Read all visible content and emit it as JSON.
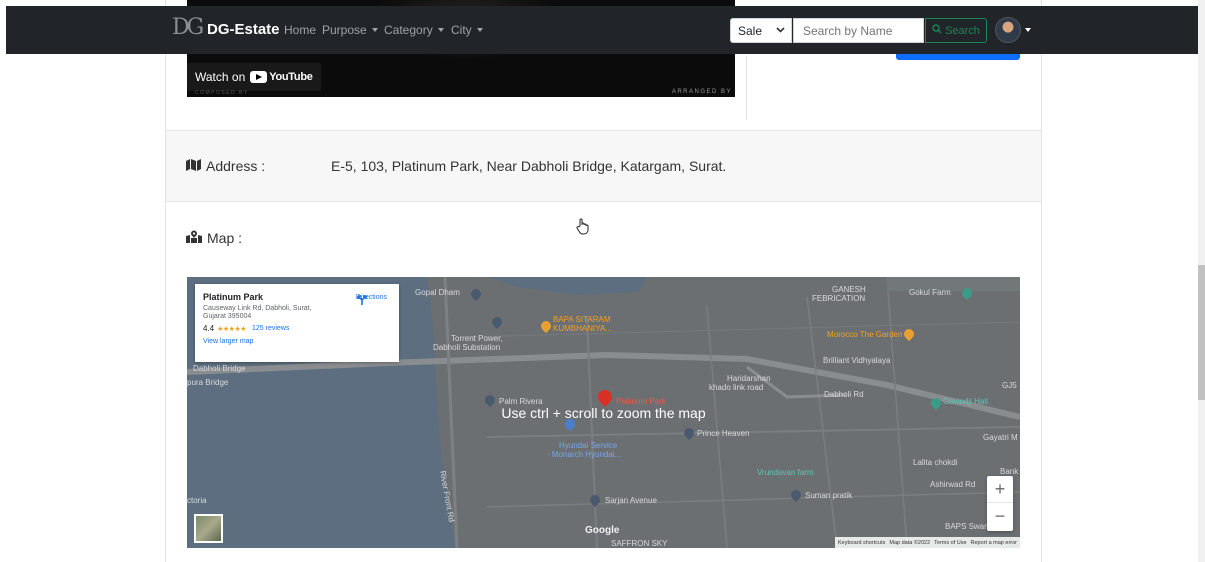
{
  "navbar": {
    "brand_icon": "DG",
    "brand": "DG-Estate",
    "links": [
      "Home",
      "Purpose",
      "Category",
      "City"
    ],
    "purpose_select": {
      "value": "Sale"
    },
    "search": {
      "placeholder": "Search by Name",
      "button_label": "Search"
    }
  },
  "video": {
    "watch_on": "Watch on",
    "youtube": "YouTube",
    "arranged_by": "ARRANGED BY",
    "composed_by": "COMPOSED BY"
  },
  "address": {
    "label": "Address :",
    "value": "E-5, 103, Platinum Park, Near Dabholi Bridge, Katargam, Surat."
  },
  "map_section": {
    "label": "Map :",
    "overlay_message": "Use ctrl + scroll to zoom the map",
    "place_card": {
      "name": "Platinum Park",
      "address": "Causeway Link Rd, Dabholi, Surat, Gujarat 395004",
      "rating": "4.4",
      "stars": "★★★★★",
      "reviews": "125 reviews",
      "view_larger": "View larger map",
      "directions": "Directions"
    },
    "labels": {
      "gopal_dham": "Gopal Dham",
      "bapa_sitaram": "BAPA SITARAM",
      "kumbhaniya": "KUMBHANIYA...",
      "torrent_power": "Torrent Power,",
      "dabholi_substation": "Dabholi Substation",
      "dabholi_bridge": "Dabholi Bridge",
      "pura_bridge": "pura Bridge",
      "palm_rivera": "Palm Rivera",
      "platinum_park": "Platinum Park",
      "hyundai_service": "Hyundai Service",
      "monarch_hyundai": "- Monarch Hyundai...",
      "prince_heaven": "Prince Heaven",
      "haridarshan": "Haridarshan",
      "khado_link_road": "khado link road",
      "ganesh": "GANESH",
      "febrication": "FEBRICATION",
      "gokul_farm": "Gokul Farm",
      "morocco_garden": "Morocco The Garden",
      "brilliant_vidhyalaya": "Brilliant Vidhyalaya",
      "dabholi_rd": "Dabholi Rd",
      "govindji_hall": "Govindji Hall",
      "gayatri": "Gayatri M",
      "gj5": "GJ5",
      "vrundavan_farm": "Vrundavan farm",
      "lalita_chokdi": "Lalita chokdi",
      "bank": "Bank",
      "suman_pratik": "Suman pratik",
      "ashirwad_rd": "Ashirwad Rd",
      "sarjan_avenue": "Sarjan Avenue",
      "river_front_rd": "River Front Rd",
      "toria": "ctoria",
      "baps": "BAPS Swaminar",
      "saffron_sky": "SAFFRON SKY"
    },
    "google": "Google",
    "attribution": [
      "Keyboard shortcuts",
      "Map data ©2022",
      "Terms of Use",
      "Report a map error"
    ],
    "zoom_in": "+",
    "zoom_out": "−"
  },
  "icons": {
    "brand": "dg-logo-icon",
    "address": "map-icon",
    "map": "map-marked-icon",
    "search": "search-icon",
    "cursor": "hand-pointer-icon",
    "directions": "directions-icon"
  },
  "colors": {
    "navbar": "#212529",
    "primary": "#0d6efd",
    "success": "#198754",
    "map_water": "#5f6f7e",
    "map_land": "#6b6f72",
    "pin_red": "#d93025"
  }
}
